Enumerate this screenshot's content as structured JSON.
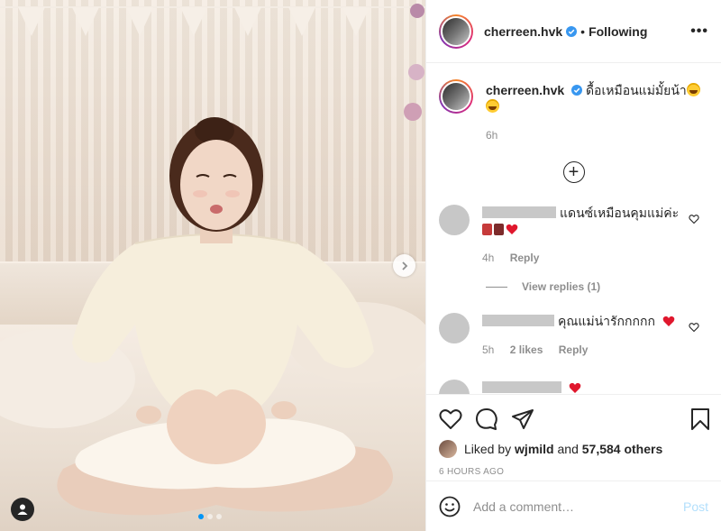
{
  "post": {
    "username": "cherreen.hvk",
    "follow_status": "Following",
    "separator": "•",
    "more_icon": "•••",
    "caption": "ดื้อเหมือนแม่มั้ยน้า",
    "caption_time": "6h",
    "load_more_icon": "+"
  },
  "comments": [
    {
      "text": "แดนซ์เหมือนคุมแม่ค่ะ",
      "time": "4h",
      "reply_label": "Reply",
      "view_replies": "View replies (1)"
    },
    {
      "text": "คุณแม่น่ารักกกกก",
      "time": "5h",
      "likes": "2 likes",
      "reply_label": "Reply"
    }
  ],
  "likes": {
    "prefix": "Liked by",
    "user": "wjmild",
    "conj": "and",
    "count": "57,584 others"
  },
  "posted_time": "6 HOURS AGO",
  "comment_box": {
    "placeholder": "Add a comment…",
    "post_label": "Post"
  },
  "colors": {
    "verified": "#3897f0",
    "heart": "#ed4956",
    "link_disabled": "#b2dffc",
    "active_dot": "#0095f6"
  },
  "icons": [
    "verified-icon",
    "more-options-icon",
    "add-circle-icon",
    "heart-icon",
    "comment-icon",
    "share-icon",
    "bookmark-icon",
    "emoji-icon",
    "chevron-right-icon",
    "user-tag-icon"
  ]
}
